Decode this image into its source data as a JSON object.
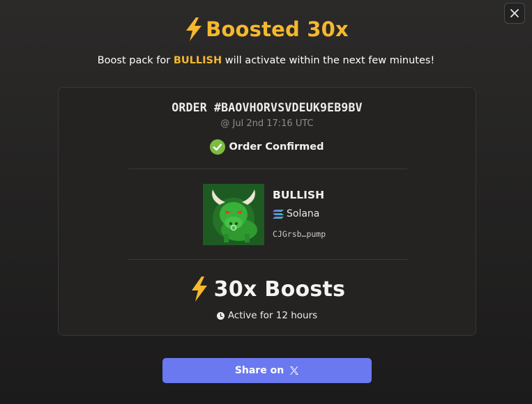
{
  "title": {
    "text": "Boosted 30x",
    "icon": "lightning-bolt-icon",
    "color": "#f5b82e"
  },
  "subtitle": {
    "prefix": "Boost pack for ",
    "token": "BULLISH",
    "suffix": " will activate within the next few minutes!"
  },
  "order": {
    "id": "ORDER #BAOVHORVSVDEUK9EB9BV",
    "date": "@ Jul 2nd 17:16 UTC",
    "status": "Order Confirmed",
    "status_icon": "check-circle-icon",
    "status_color": "#7dbb42"
  },
  "token": {
    "name": "BULLISH",
    "chain": "Solana",
    "chain_icon": "solana-icon",
    "address": "CJGrsb…pump",
    "avatar_icon": "green-bull-icon"
  },
  "boost": {
    "label": "30x Boosts",
    "icon": "lightning-bolt-icon",
    "duration": "Active for 12 hours",
    "duration_icon": "clock-icon"
  },
  "share": {
    "label": "Share on",
    "icon": "x-logo-icon",
    "color": "#6a79f0"
  },
  "close": {
    "icon": "close-icon"
  }
}
